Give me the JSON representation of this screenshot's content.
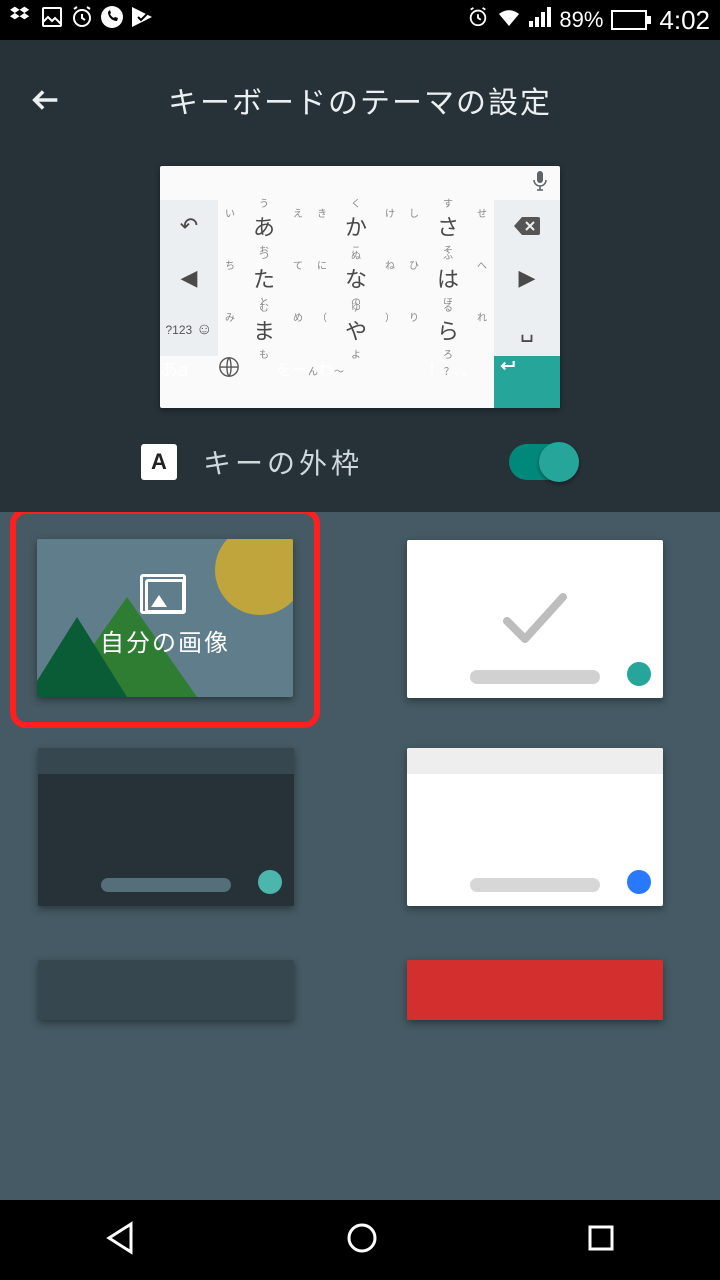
{
  "status": {
    "battery_pct": "89%",
    "time": "4:02"
  },
  "header": {
    "title": "キーボードのテーマの設定"
  },
  "preview_keys": {
    "r1k1": {
      "t": "う",
      "m": "あ",
      "l": "い",
      "r": "え",
      "b": "お"
    },
    "r1k2": {
      "t": "く",
      "m": "か",
      "l": "き",
      "r": "け",
      "b": "こ"
    },
    "r1k3": {
      "t": "す",
      "m": "さ",
      "l": "し",
      "r": "せ",
      "b": "そ"
    },
    "r2k1": {
      "t": "つ",
      "m": "た",
      "l": "ち",
      "r": "て",
      "b": "と"
    },
    "r2k2": {
      "t": "ぬ",
      "m": "な",
      "l": "に",
      "r": "ね",
      "b": "の"
    },
    "r2k3": {
      "t": "ふ",
      "m": "は",
      "l": "ひ",
      "r": "へ",
      "b": "ほ"
    },
    "r3k1": {
      "t": "む",
      "m": "ま",
      "l": "み",
      "r": "め",
      "b": "も"
    },
    "r3k2": {
      "t": "ゆ",
      "m": "や",
      "l": "（",
      "r": "）",
      "b": "よ"
    },
    "r3k3": {
      "t": "る",
      "m": "ら",
      "l": "り",
      "r": "れ",
      "b": "ろ"
    },
    "r4k1": {
      "m": "あa"
    },
    "r4k2": {
      "t": "ん",
      "m": "わ",
      "l": "を",
      "r": "ー",
      "b": "〜"
    },
    "r4k3": {
      "t": "？",
      "m": "、。",
      "r": "！"
    },
    "num_label": "?123"
  },
  "toggle": {
    "icon_letter": "A",
    "label": "キーの外枠",
    "enabled": true
  },
  "themes": {
    "my_image_label": "自分の画像",
    "items": [
      {
        "id": "my-image"
      },
      {
        "id": "light-teal",
        "selected": true,
        "dot": "#26a69a",
        "bg": "#ffffff"
      },
      {
        "id": "dark-teal",
        "dot": "#4db6ac",
        "bg": "#263238"
      },
      {
        "id": "light-blue",
        "dot": "#2979ff",
        "bg": "#ffffff"
      },
      {
        "id": "dark-gray"
      },
      {
        "id": "red"
      }
    ]
  }
}
